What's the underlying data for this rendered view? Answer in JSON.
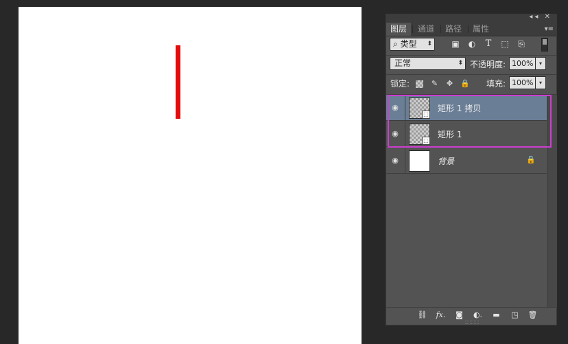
{
  "canvas": {
    "background": "#ffffff",
    "shape_color": "#e30b0b"
  },
  "panel": {
    "collapse_glyph": "◂◂",
    "close_glyph": "✕",
    "menu_glyph": "▾≡",
    "tabs": [
      {
        "label": "图层",
        "active": true
      },
      {
        "label": "通道",
        "active": false
      },
      {
        "label": "路径",
        "active": false
      },
      {
        "label": "属性",
        "active": false
      }
    ],
    "filter": {
      "search_glyph": "⌕",
      "value": "类型",
      "arrow": "⬍",
      "icons": [
        {
          "name": "image-filter-icon",
          "glyph": "▣"
        },
        {
          "name": "adjustment-filter-icon",
          "glyph": "◐"
        },
        {
          "name": "type-filter-icon",
          "glyph": "T"
        },
        {
          "name": "shape-filter-icon",
          "glyph": "⬚"
        },
        {
          "name": "smart-object-filter-icon",
          "glyph": "⎘"
        }
      ]
    },
    "blend_mode": "正常",
    "blend_arrow": "⬍",
    "opacity_label": "不透明度:",
    "opacity_value": "100%",
    "lock_label": "锁定:",
    "lock_icons": [
      {
        "name": "lock-transparent-icon",
        "glyph": ""
      },
      {
        "name": "lock-image-icon",
        "glyph": "✎"
      },
      {
        "name": "lock-position-icon",
        "glyph": "✥"
      },
      {
        "name": "lock-all-icon",
        "glyph": "🔒"
      }
    ],
    "fill_label": "填充:",
    "fill_value": "100%",
    "spin_glyph": "▾",
    "layers": [
      {
        "name": "矩形 1 拷贝",
        "selected": true,
        "thumb": "transparent",
        "badge_glyph": "⬚",
        "eye_glyph": "◉"
      },
      {
        "name": "矩形 1",
        "selected": false,
        "thumb": "transparent",
        "badge_glyph": "⬚",
        "eye_glyph": "◉"
      },
      {
        "name": "背景",
        "selected": false,
        "thumb": "white",
        "locked": true,
        "eye_glyph": "◉",
        "lock_glyph": "🔒"
      }
    ],
    "bottom_icons": [
      {
        "name": "link-layers-icon",
        "glyph": "⛓"
      },
      {
        "name": "layer-style-icon",
        "glyph": "fx."
      },
      {
        "name": "add-mask-icon",
        "glyph": "◙"
      },
      {
        "name": "new-adjustment-icon",
        "glyph": "◐."
      },
      {
        "name": "new-group-icon",
        "glyph": "▬"
      },
      {
        "name": "new-layer-icon",
        "glyph": "◳"
      },
      {
        "name": "delete-layer-icon",
        "glyph": "🗑"
      }
    ]
  },
  "colors": {
    "highlight": "#cc3ed2",
    "selected_row": "#6a7e96"
  }
}
